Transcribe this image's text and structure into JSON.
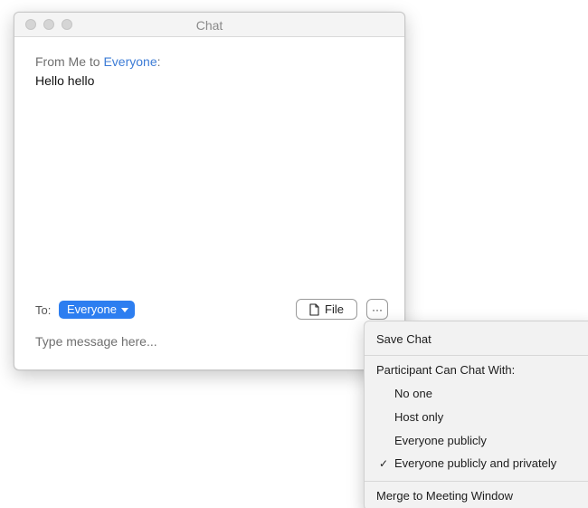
{
  "window": {
    "title": "Chat"
  },
  "messages": [
    {
      "header_prefix": "From Me to ",
      "recipient": "Everyone",
      "header_suffix": ":",
      "text": "Hello hello"
    }
  ],
  "composer": {
    "to_label": "To:",
    "recipient": "Everyone",
    "file_label": "File",
    "more_label": "···",
    "placeholder": "Type message here..."
  },
  "menu": {
    "save_chat": "Save Chat",
    "section_title": "Participant Can Chat With:",
    "options": [
      {
        "label": "No one",
        "checked": false
      },
      {
        "label": "Host only",
        "checked": false
      },
      {
        "label": "Everyone publicly",
        "checked": false
      },
      {
        "label": "Everyone publicly and privately",
        "checked": true
      }
    ],
    "check_mark": "✓",
    "merge": "Merge to Meeting Window"
  },
  "colors": {
    "accent": "#2d7ef0",
    "recipient_link": "#3d7cd6"
  },
  "icons": {
    "file": "document-icon",
    "more": "more-horizontal-icon",
    "caret": "caret-down-icon",
    "check": "checkmark-icon"
  }
}
